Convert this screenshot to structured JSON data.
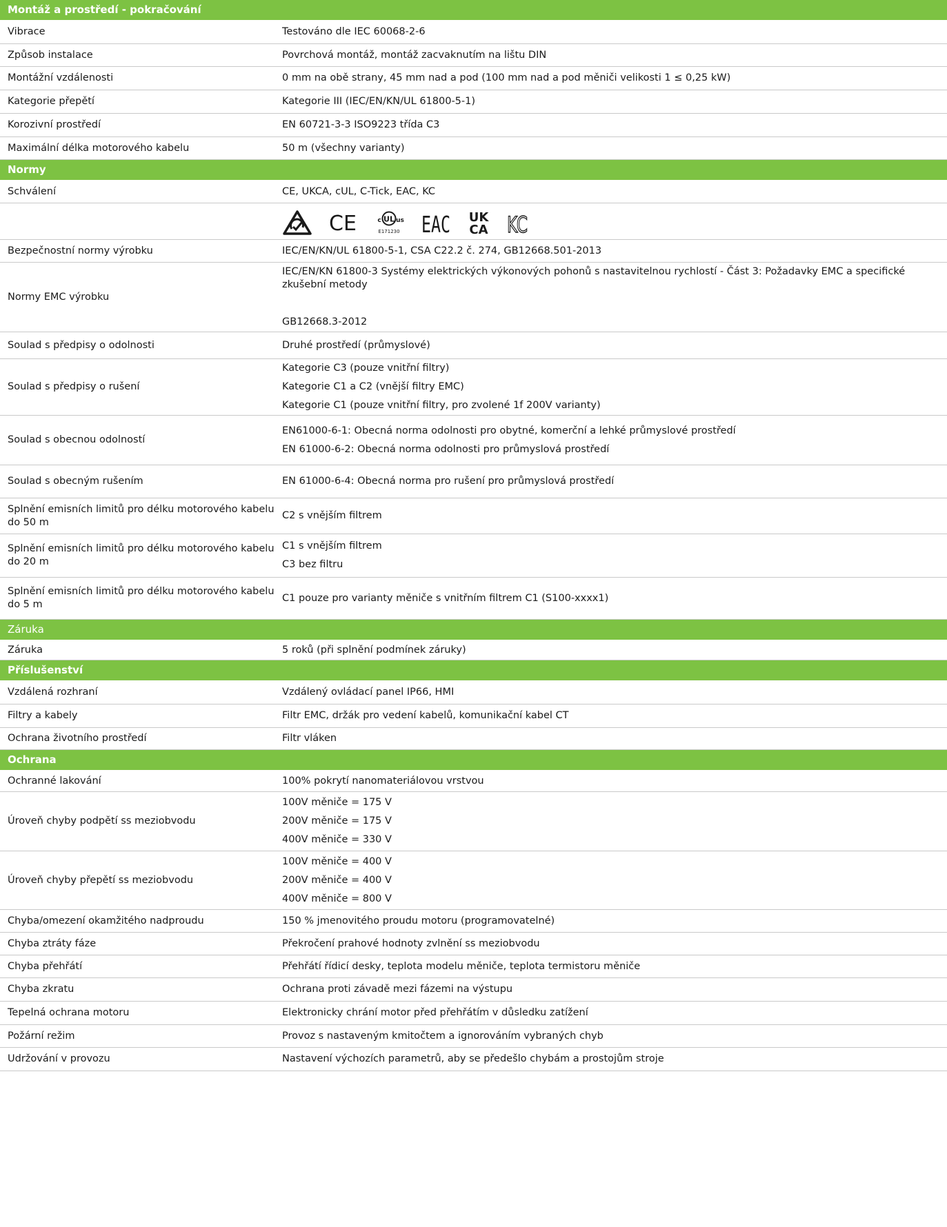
{
  "sections": [
    {
      "title": "Montáž a prostředí - pokračování",
      "bold": true,
      "rows": [
        {
          "label": "Vibrace",
          "values": [
            "Testováno dle IEC 60068-2-6"
          ],
          "h": 34
        },
        {
          "label": "Způsob instalace",
          "values": [
            "Povrchová montáž, montáž zacvaknutím na lištu DIN"
          ],
          "h": 33
        },
        {
          "label": "Montážní vzdálenosti",
          "values": [
            "0 mm na obě strany, 45 mm nad a pod (100 mm nad a pod měniči velikosti 1 ≤ 0,25 kW)"
          ],
          "h": 34
        },
        {
          "label": "Kategorie přepětí",
          "values": [
            "Kategorie III (IEC/EN/KN/UL 61800-5-1)"
          ],
          "h": 34
        },
        {
          "label": "Korozivní prostředí",
          "values": [
            "EN 60721-3-3 ISO9223 třída C3"
          ],
          "h": 34
        },
        {
          "label": "Maximální délka motorového kabelu",
          "values": [
            "50 m (všechny varianty)"
          ],
          "h": 33
        }
      ]
    },
    {
      "title": "Normy",
      "bold": true,
      "rows": [
        {
          "label": "Schválení",
          "values": [
            "CE, UKCA, cUL, C-Tick, EAC, KC"
          ],
          "h": 33
        },
        {
          "label": "",
          "values": [],
          "logos": true,
          "h": 53
        },
        {
          "label": "Bezpečnostní normy výrobku",
          "values": [
            "IEC/EN/KN/UL 61800-5-1, CSA C22.2 č. 274, GB12668.501-2013"
          ],
          "h": 33
        },
        {
          "label": "Normy EMC výrobku",
          "values": [
            "IEC/EN/KN 61800-3 Systémy elektrických výkonových pohonů s nastavitelnou rychlostí - Část 3: Požadavky EMC a specifické zkušební metody",
            "",
            "GB12668.3-2012"
          ],
          "h": 101
        },
        {
          "label": "Soulad s předpisy o odolnosti",
          "values": [
            "Druhé prostředí (průmyslové)"
          ],
          "h": 39
        },
        {
          "label": "Soulad s předpisy o rušení",
          "values": [
            "Kategorie C3 (pouze vnitřní filtry)",
            "Kategorie C1 a C2 (vnější filtry EMC)",
            "Kategorie C1 (pouze vnitřní filtry, pro zvolené 1f 200V varianty)"
          ],
          "h": 82
        },
        {
          "label": "Soulad s obecnou odolností",
          "values": [
            "EN61000-6-1: Obecná norma odolnosti pro obytné, komerční a lehké průmyslové prostředí",
            "EN 61000-6-2: Obecná norma odolnosti pro průmyslová prostředí"
          ],
          "h": 72
        },
        {
          "label": "Soulad s obecným rušením",
          "values": [
            "EN 61000-6-4: Obecná norma pro rušení pro průmyslová prostředí"
          ],
          "h": 48
        },
        {
          "label": "Splnění emisních limitů pro délku motorového kabelu do 50 m",
          "values": [
            "C2 s vnějším filtrem"
          ],
          "h": 52
        },
        {
          "label": "Splnění emisních limitů pro délku motorového kabelu do 20 m",
          "values": [
            "C1 s vnějším filtrem",
            "C3 bez filtru"
          ],
          "h": 63
        },
        {
          "label": "Splnění emisních limitů pro délku motorového kabelu do 5 m",
          "values": [
            "C1 pouze pro varianty měniče s vnitřním filtrem C1 (S100-xxxx1)"
          ],
          "h": 61
        }
      ]
    },
    {
      "title": "Záruka",
      "bold": false,
      "rows": [
        {
          "label": "Záruka",
          "values": [
            "5 roků (při splnění podmínek záruky)"
          ],
          "h": 29
        }
      ]
    },
    {
      "title": "Příslušenství",
      "bold": true,
      "rows": [
        {
          "label": "Vzdálená rozhraní",
          "values": [
            "Vzdálený ovládací panel IP66, HMI"
          ],
          "h": 34
        },
        {
          "label": "Filtry a kabely",
          "values": [
            "Filtr EMC, držák pro vedení kabelů, komunikační kabel CT"
          ],
          "h": 34
        },
        {
          "label": "Ochrana životního prostředí",
          "values": [
            "Filtr vláken"
          ],
          "h": 32
        }
      ]
    },
    {
      "title": "Ochrana",
      "bold": true,
      "rows": [
        {
          "label": "Ochranné lakování",
          "values": [
            "100% pokrytí nanomateriálovou vrstvou"
          ],
          "h": 31
        },
        {
          "label": "Úroveň chyby podpětí ss meziobvodu",
          "values": [
            "100V měniče = 175 V",
            "200V měniče = 175 V",
            "400V měniče = 330 V"
          ],
          "h": 86
        },
        {
          "label": "Úroveň chyby přepětí ss meziobvodu",
          "values": [
            "100V měniče = 400 V",
            "200V měniče = 400 V",
            "400V měniče = 800 V"
          ],
          "h": 85
        },
        {
          "label": "Chyba/omezení okamžitého nadproudu",
          "values": [
            "150 % jmenovitého proudu motoru (programovatelné)"
          ],
          "h": 33
        },
        {
          "label": "Chyba ztráty fáze",
          "values": [
            "Překročení prahové hodnoty zvlnění ss meziobvodu"
          ],
          "h": 33
        },
        {
          "label": "Chyba přehřátí",
          "values": [
            "Přehřátí řídicí desky, teplota modelu měniče, teplota termistoru měniče"
          ],
          "h": 33
        },
        {
          "label": "Chyba zkratu",
          "values": [
            "Ochrana proti závadě mezi fázemi na výstupu"
          ],
          "h": 34
        },
        {
          "label": "Tepelná ochrana motoru",
          "values": [
            "Elektronicky chrání motor před přehřátím v důsledku zatížení"
          ],
          "h": 34
        },
        {
          "label": "Požární režim",
          "values": [
            "Provoz s nastaveným kmitočtem a ignorováním vybraných chyb"
          ],
          "h": 33
        },
        {
          "label": "Udržování v provozu",
          "values": [
            "Nastavení výchozích parametrů, aby se předešlo chybám a prostojům stroje"
          ],
          "h": 34
        }
      ]
    }
  ],
  "logos": [
    {
      "name": "rcm-mark-icon"
    },
    {
      "name": "ce-mark-icon",
      "text": "CE"
    },
    {
      "name": "cul-us-mark-icon",
      "text": "UL",
      "c": "c",
      "us": "us",
      "code": "E171230"
    },
    {
      "name": "eac-mark-icon",
      "text": "EAC"
    },
    {
      "name": "ukca-mark-icon",
      "text": "UK CA"
    },
    {
      "name": "kc-mark-icon",
      "text": "KC"
    }
  ],
  "colors": {
    "accent": "#7dc243",
    "border": "#c9c9c9",
    "text": "#1a1a1a"
  }
}
